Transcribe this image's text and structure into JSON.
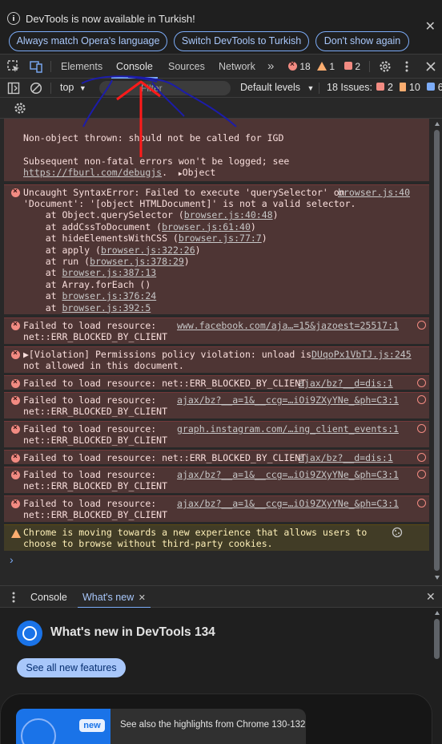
{
  "infobar": {
    "title": "DevTools is now available in Turkish!",
    "buttons": [
      "Always match Opera's language",
      "Switch DevTools to Turkish",
      "Don't show again"
    ],
    "close": "✕"
  },
  "tabs": {
    "items": [
      "Elements",
      "Console",
      "Sources",
      "Network"
    ],
    "active": "Console",
    "more": "»",
    "errors": "18",
    "warnings": "1",
    "issues": "2"
  },
  "console_toolbar": {
    "context": "top",
    "filter_placeholder": "Filter",
    "levels": "Default levels",
    "issues_label": "18 Issues:",
    "issue_counts": {
      "errors": "2",
      "warnings": "10",
      "info": "6"
    }
  },
  "messages": [
    {
      "type": "error",
      "lines": [
        "Non-object thrown: should not be called for IGD",
        "",
        "Subsequent non-fatal errors won't be logged; see"
      ],
      "link": "https://fburl.com/debugjs",
      "object": "Object"
    },
    {
      "type": "error",
      "first": "Uncaught SyntaxError: Failed to execute 'querySelector' on",
      "source": "browser.js:40",
      "lines": [
        "'Document': '[object HTMLDocument]' is not a valid selector.",
        "    at Object.querySelector (browser.js:40:48)",
        "    at addCssToDocument (browser.js:61:40)",
        "    at hideElementsWithCSS (browser.js:77:7)",
        "    at apply (browser.js:322:26)",
        "    at run (browser.js:378:29)",
        "    at browser.js:387:13",
        "    at Array.forEach (<anonymous>)",
        "    at browser.js:376:24",
        "    at browser.js:392:5"
      ]
    },
    {
      "type": "error",
      "first": "Failed to load resource:",
      "second": "net::ERR_BLOCKED_BY_CLIENT",
      "source": "www.facebook.com/aja…=15&jazoest=25517:1"
    },
    {
      "type": "error",
      "first": "▶[Violation] Permissions policy violation: unload is",
      "second": "not allowed in this document.",
      "source": "DUqoPx1VbTJ.js:245"
    },
    {
      "type": "error",
      "first": "Failed to load resource: net::ERR_BLOCKED_BY_CLIENT",
      "source": "ajax/bz?__d=dis:1"
    },
    {
      "type": "error",
      "first": "Failed to load resource:",
      "second": "net::ERR_BLOCKED_BY_CLIENT",
      "source": "ajax/bz?__a=1&__ccg=…iOi9ZXyYNe_&ph=C3:1"
    },
    {
      "type": "error",
      "first": "Failed to load resource:",
      "second": "net::ERR_BLOCKED_BY_CLIENT",
      "source": "graph.instagram.com/…ing_client_events:1"
    },
    {
      "type": "error",
      "first": "Failed to load resource: net::ERR_BLOCKED_BY_CLIENT",
      "source": "ajax/bz?__d=dis:1"
    },
    {
      "type": "error",
      "first": "Failed to load resource:",
      "second": "net::ERR_BLOCKED_BY_CLIENT",
      "source": "ajax/bz?__a=1&__ccg=…iOi9ZXyYNe_&ph=C3:1"
    },
    {
      "type": "error",
      "first": "Failed to load resource:",
      "second": "net::ERR_BLOCKED_BY_CLIENT",
      "source": "ajax/bz?__a=1&__ccg=…iOi9ZXyYNe_&ph=C3:1"
    },
    {
      "type": "warning",
      "first": "Chrome is moving towards a new experience that allows users to",
      "second": "choose to browse without third-party cookies."
    }
  ],
  "prompt": "›",
  "drawer": {
    "tabs": [
      "Console",
      "What's new"
    ],
    "active": "What's new",
    "tab_close": "✕",
    "close": "✕",
    "whats_new_title": "What's new in DevTools 134",
    "see_all": "See all new features",
    "badge": "new",
    "card_text": "See also the highlights from Chrome 130-132"
  },
  "colors": {
    "accent": "#7cacf8",
    "error_bg": "#4e3534",
    "warning_bg": "#413c26",
    "annotation_red": "#ff1a1a",
    "annotation_blue": "#1c1caa"
  }
}
